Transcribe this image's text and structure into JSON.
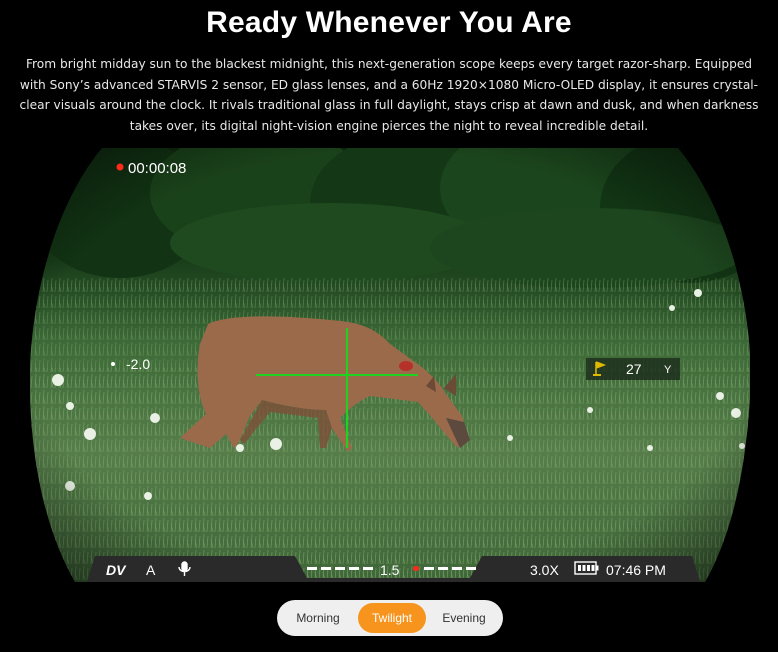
{
  "heading": "Ready Whenever You Are",
  "description": "From bright midday sun to the blackest midnight, this next-generation scope keeps every target razor-sharp. Equipped with Sony’s advanced STARVIS 2 sensor, ED glass lenses, and a 60Hz 1920×1080 Micro-OLED display, it ensures crystal-clear visuals around the clock. It rivals traditional glass in full daylight, stays crisp at dawn and dusk, and when darkness takes over, its digital night-vision engine pierces the night to reveal incredible detail.",
  "scope": {
    "record_time": "00:00:08",
    "left_marker": "-2.0",
    "range_value": "27",
    "range_unit": "Y",
    "status_bar": {
      "brand": "DV",
      "mode": "A",
      "center_value": "1.5",
      "zoom": "3.0X",
      "time": "07:46 PM"
    },
    "colors": {
      "reticle": "#1fd21f",
      "record_dot": "#ff2a1a",
      "range_icon": "#e0b800"
    },
    "icons": [
      "record-dot-icon",
      "microphone-icon",
      "battery-icon",
      "range-flag-icon"
    ]
  },
  "modes": {
    "options": [
      "Morning",
      "Twilight",
      "Evening"
    ],
    "selected": "Twilight",
    "accent": "#f7941d"
  }
}
